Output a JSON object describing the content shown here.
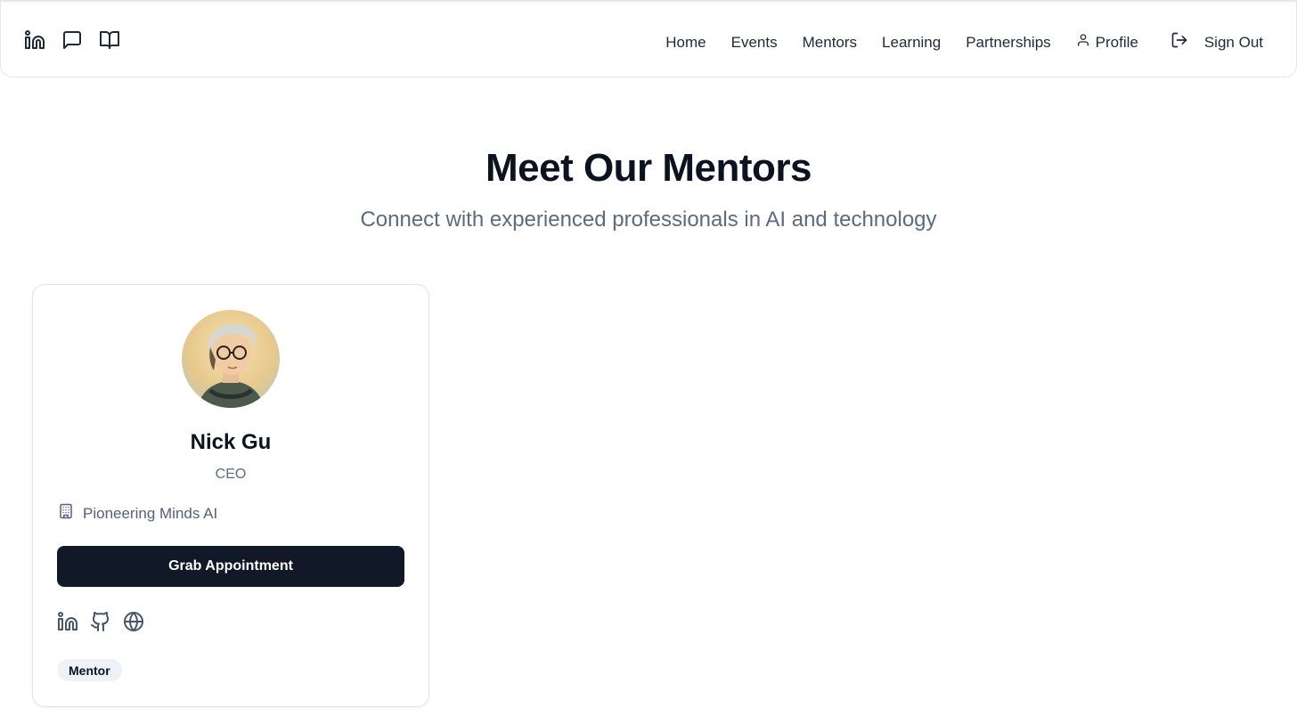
{
  "header": {
    "icons": [
      "linkedin-icon",
      "message-square-icon",
      "book-open-icon"
    ],
    "nav": [
      "Home",
      "Events",
      "Mentors",
      "Learning",
      "Partnerships"
    ],
    "profile_label": "Profile",
    "signout_label": "Sign Out"
  },
  "hero": {
    "title": "Meet Our Mentors",
    "subtitle": "Connect with experienced professionals in AI and technology"
  },
  "mentor": {
    "name": "Nick Gu",
    "role": "CEO",
    "company": "Pioneering Minds AI",
    "button_label": "Grab Appointment",
    "social_icons": [
      "linkedin-icon",
      "github-icon",
      "globe-icon"
    ],
    "badge": "Mentor"
  },
  "colors": {
    "button_bg": "#111827",
    "muted_text": "#5a6b82",
    "badge_bg": "#eef2f7"
  }
}
